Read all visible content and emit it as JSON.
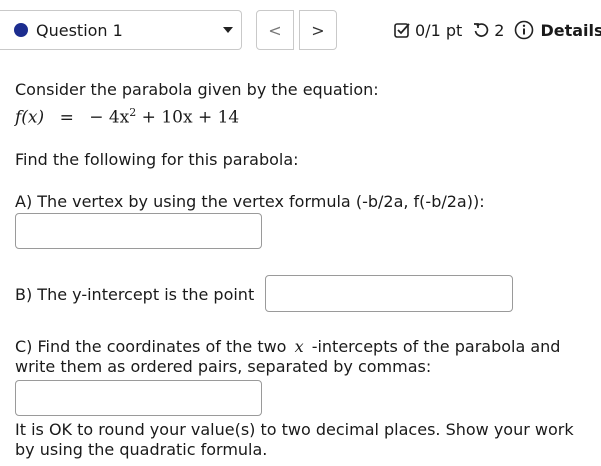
{
  "question_nav": {
    "selected_question": "Question 1",
    "prev_label": "<",
    "next_label": ">"
  },
  "status_bar": {
    "score": "0/1 pt",
    "retries": "2",
    "details_label": "Details"
  },
  "question": {
    "intro": "Consider the parabola given by the equation:",
    "equation": {
      "lhs": "f(x)",
      "equals": "=",
      "rhs_terms": [
        "− 4x",
        "2",
        " + 10x + 14"
      ]
    },
    "find_prompt": "Find the following for this parabola:",
    "part_a": "A) The vertex by using the vertex formula (-b/2a, f(-b/2a)):",
    "part_b": "B) The y-intercept is the point",
    "part_c_line1_pre": "C) Find the coordinates of the two",
    "part_c_var": "x",
    "part_c_line1_post": "-intercepts of the parabola and",
    "part_c_line2": "write them as ordered pairs, separated by commas:",
    "note_line1": "It is OK to round your value(s) to two decimal places. Show your work",
    "note_line2": "by using the quadratic formula."
  },
  "answers": {
    "a_value": "",
    "b_value": "",
    "c_value": ""
  },
  "colors": {
    "question_dot": "#1c2d8f",
    "border": "#9a9a9a"
  }
}
